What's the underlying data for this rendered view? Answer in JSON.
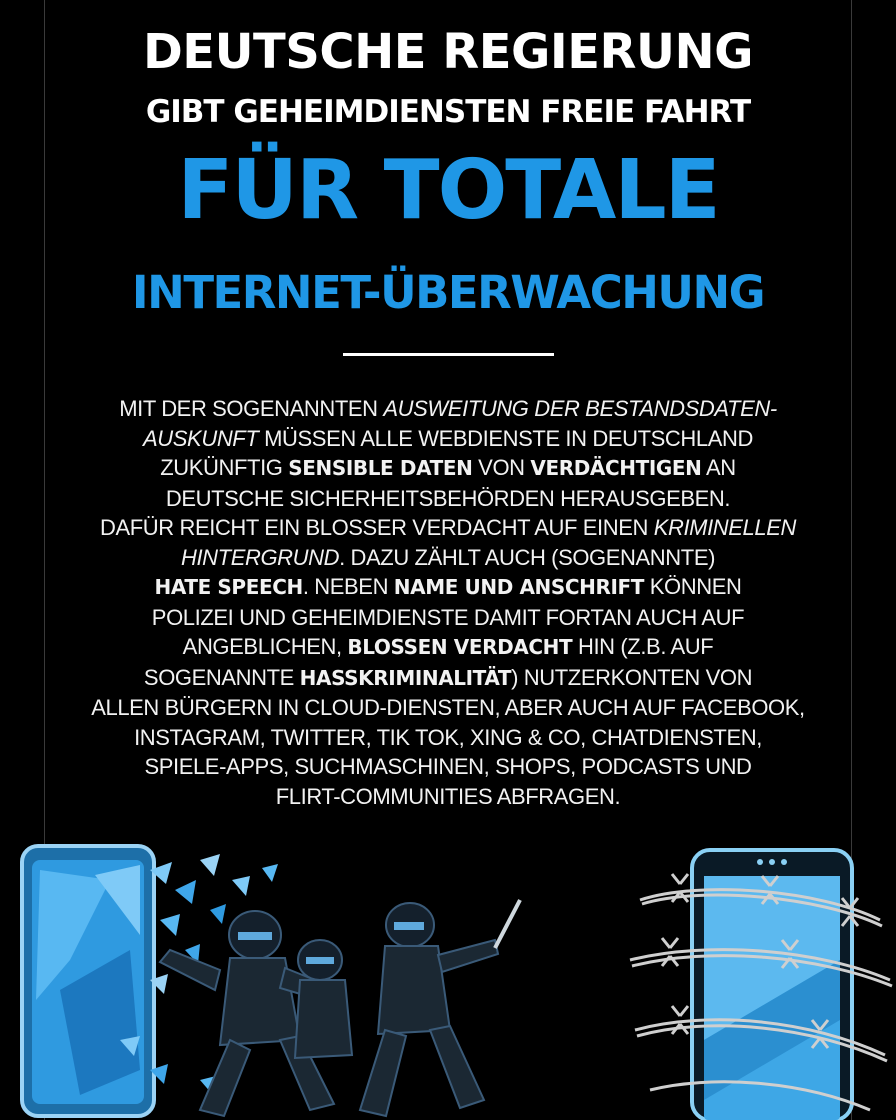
{
  "headline": {
    "line1": "DEUTSCHE REGIERUNG",
    "line2": "GIBT GEHEIMDIENSTEN FREIE FAHRT",
    "line3": "FÜR TOTALE",
    "line4": "INTERNET-ÜBERWACHUNG"
  },
  "colors": {
    "background": "#000000",
    "accent_blue": "#1f97e6",
    "text_white": "#ffffff"
  },
  "body": {
    "l1a": "MIT DER SOGENANNTEN ",
    "l1b": "AUSWEITUNG DER BESTANDSDATEN-",
    "l2a": "AUSKUNFT",
    "l2b": " MÜSSEN ALLE WEBDIENSTE IN DEUTSCHLAND",
    "l3a": "ZUKÜNFTIG ",
    "l3b": "SENSIBLE DATEN",
    "l3c": " VON ",
    "l3d": "VERDÄCHTIGEN",
    "l3e": " AN",
    "l4": "DEUTSCHE SICHERHEITSBEHÖRDEN HERAUSGEBEN.",
    "l5a": "DAFÜR REICHT EIN BLOSSER VERDACHT AUF EINEN ",
    "l5b": "KRIMINELLEN",
    "l6a": "HINTERGRUND",
    "l6b": ". DAZU ZÄHLT AUCH (SOGENANNTE)",
    "l7a": "HATE SPEECH",
    "l7b": ". NEBEN ",
    "l7c": "NAME UND ANSCHRIFT",
    "l7d": " KÖNNEN",
    "l8": "POLIZEI UND GEHEIMDIENSTE DAMIT FORTAN AUCH AUF",
    "l9a": "ANGEBLICHEN, ",
    "l9b": "BLOSSEN VERDACHT",
    "l9c": " HIN (Z.B. AUF",
    "l10a": "SOGENANNTE ",
    "l10b": "HASSKRIMINALITÄT",
    "l10c": ") NUTZERKONTEN VON",
    "l11": "ALLEN BÜRGERN IN CLOUD-DIENSTEN, ABER AUCH AUF FACEBOOK,",
    "l12": "INSTAGRAM, TWITTER, TIK TOK, XING & CO, CHATDIENSTEN,",
    "l13": "SPIELE-APPS, SUCHMASCHINEN, SHOPS, PODCASTS UND",
    "l14": "FLIRT-COMMUNITIES ABFRAGEN."
  },
  "illustrations": {
    "left_icon": "riot-police-breaking-phone-illustration",
    "right_icon": "phone-wrapped-in-barbed-wire-illustration"
  }
}
